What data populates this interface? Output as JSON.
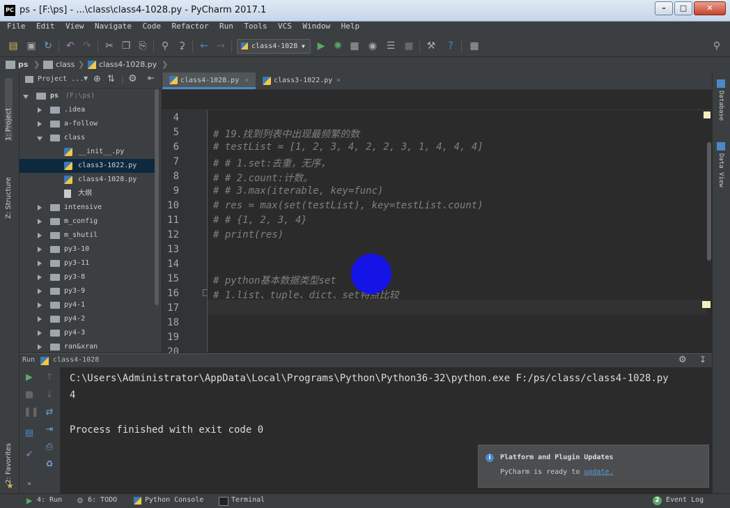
{
  "window": {
    "title": "ps - [F:\\ps] - ...\\class\\class4-1028.py - PyCharm 2017.1",
    "app_icon": "PC"
  },
  "menu": [
    "File",
    "Edit",
    "View",
    "Navigate",
    "Code",
    "Refactor",
    "Run",
    "Tools",
    "VCS",
    "Window",
    "Help"
  ],
  "toolbar": {
    "run_config": "class4-1028"
  },
  "navbar": {
    "crumbs": [
      "ps",
      "class",
      "class4-1028.py"
    ]
  },
  "left_stripe": {
    "project": "1: Project",
    "structure": "Z: Structure",
    "favorites": "2: Favorites"
  },
  "project_panel": {
    "header": "Project ..."
  },
  "tree": [
    {
      "label": "ps",
      "suffix": " (F:\\ps)",
      "type": "folder",
      "expanded": true,
      "level": 0
    },
    {
      "label": ".idea",
      "type": "folder",
      "expanded": false,
      "level": 1
    },
    {
      "label": "a-follow",
      "type": "folder",
      "expanded": false,
      "level": 1
    },
    {
      "label": "class",
      "type": "folder",
      "expanded": true,
      "level": 1
    },
    {
      "label": "__init__.py",
      "type": "py",
      "level": 2
    },
    {
      "label": "class3-1022.py",
      "type": "py",
      "level": 2,
      "selected": true
    },
    {
      "label": "class4-1028.py",
      "type": "py",
      "level": 2
    },
    {
      "label": "大纲",
      "type": "file",
      "level": 2
    },
    {
      "label": "intensive",
      "type": "folder",
      "expanded": false,
      "level": 1
    },
    {
      "label": "m_config",
      "type": "folder",
      "expanded": false,
      "level": 1
    },
    {
      "label": "m_shutil",
      "type": "folder",
      "expanded": false,
      "level": 1
    },
    {
      "label": "py3-10",
      "type": "folder",
      "expanded": false,
      "level": 1
    },
    {
      "label": "py3-11",
      "type": "folder",
      "expanded": false,
      "level": 1
    },
    {
      "label": "py3-8",
      "type": "folder",
      "expanded": false,
      "level": 1
    },
    {
      "label": "py3-9",
      "type": "folder",
      "expanded": false,
      "level": 1
    },
    {
      "label": "py4-1",
      "type": "folder",
      "expanded": false,
      "level": 1
    },
    {
      "label": "py4-2",
      "type": "folder",
      "expanded": false,
      "level": 1
    },
    {
      "label": "py4-3",
      "type": "folder",
      "expanded": false,
      "level": 1
    },
    {
      "label": "ran&xran",
      "type": "folder",
      "expanded": false,
      "level": 1
    }
  ],
  "editor_tabs": [
    {
      "label": "class4-1028.py",
      "active": true
    },
    {
      "label": "class3-1022.py",
      "active": false
    }
  ],
  "editor_lines": [
    {
      "n": "4",
      "text": ""
    },
    {
      "n": "5",
      "text": "# 19.找到列表中出现最频繁的数"
    },
    {
      "n": "6",
      "text": "# testList = [1, 2, 3, 4, 2, 2, 3, 1, 4, 4, 4]"
    },
    {
      "n": "7",
      "text": "# # 1.set:去重，无序，"
    },
    {
      "n": "8",
      "text": "# # 2.count:计数。"
    },
    {
      "n": "9",
      "text": "# # 3.max(iterable, key=func)"
    },
    {
      "n": "10",
      "text": "# res = max(set(testList), key=testList.count)"
    },
    {
      "n": "11",
      "text": "# # {1, 2, 3, 4}"
    },
    {
      "n": "12",
      "text": "# print(res)"
    },
    {
      "n": "13",
      "text": ""
    },
    {
      "n": "14",
      "text": ""
    },
    {
      "n": "15",
      "text": "# python基本数据类型set"
    },
    {
      "n": "16",
      "text": "# 1.list、tuple、dict、set特点比较"
    },
    {
      "n": "17",
      "text": ""
    },
    {
      "n": "18",
      "text": ""
    },
    {
      "n": "19",
      "text": ""
    },
    {
      "n": "20",
      "text": ""
    }
  ],
  "right_stripe": {
    "database": "Database",
    "data_view": "Data View"
  },
  "run_panel": {
    "title": "Run",
    "config": "class4-1028",
    "output": [
      "C:\\Users\\Administrator\\AppData\\Local\\Programs\\Python\\Python36-32\\python.exe F:/ps/class/class4-1028.py",
      "4",
      "",
      "Process finished with exit code 0"
    ]
  },
  "notification": {
    "title": "Platform and Plugin Updates",
    "body": "PyCharm is ready to ",
    "link": "update."
  },
  "statusbar": {
    "run": "4: Run",
    "todo": "6: TODO",
    "python_console": "Python Console",
    "terminal": "Terminal",
    "event_log": "Event Log",
    "event_count": "2"
  },
  "colors": {
    "accent": "#4a88c7",
    "selection": "#0d293e",
    "circle": "#1414e6",
    "run_green": "#59a869"
  }
}
